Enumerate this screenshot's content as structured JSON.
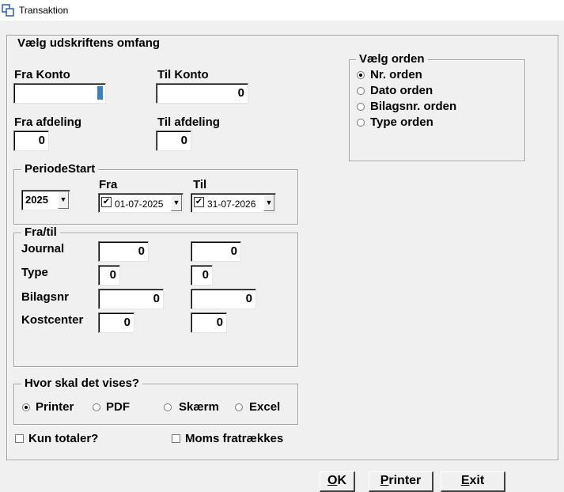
{
  "window": {
    "title": "Transaktion"
  },
  "scope": {
    "legend": "Vælg udskriftens omfang",
    "fra_konto": {
      "label": "Fra Konto",
      "value": ""
    },
    "til_konto": {
      "label": "Til Konto",
      "value": "0"
    },
    "fra_afdeling": {
      "label": "Fra afdeling",
      "value": "0"
    },
    "til_afdeling": {
      "label": "Til afdeling",
      "value": "0"
    }
  },
  "periode": {
    "legend": "PeriodeStart",
    "year": "2025",
    "fra_label": "Fra",
    "til_label": "Til",
    "fra_date": "01-07-2025",
    "til_date": "31-07-2026",
    "fra_checked": true,
    "til_checked": true
  },
  "fratil": {
    "legend": "Fra/til",
    "rows": [
      {
        "label": "Journal",
        "from": "0",
        "to": "0"
      },
      {
        "label": "Type",
        "from": "0",
        "to": "0"
      },
      {
        "label": "Bilagsnr",
        "from": "0",
        "to": "0"
      },
      {
        "label": "Kostcenter",
        "from": "0",
        "to": "0"
      }
    ]
  },
  "output": {
    "legend": "Hvor skal det vises?",
    "options": [
      "Printer",
      "PDF",
      "Skærm",
      "Excel"
    ],
    "selected": "Printer"
  },
  "order": {
    "legend": "Vælg orden",
    "options": [
      "Nr. orden",
      "Dato orden",
      "Bilagsnr. orden",
      "Type orden"
    ],
    "selected": "Nr. orden"
  },
  "checkboxes": {
    "kun_totaler": {
      "label": "Kun totaler?",
      "checked": false
    },
    "moms": {
      "label": "Moms fratrækkes",
      "checked": false
    }
  },
  "buttons": {
    "ok": {
      "mnemonic": "O",
      "rest": "K"
    },
    "printer": {
      "mnemonic": "P",
      "rest": "rinter"
    },
    "exit": {
      "mnemonic": "E",
      "rest": "xit"
    }
  },
  "icons": {
    "app": "transaction-windows-icon",
    "dropdown": "chevron-down-icon",
    "check": "checkmark-icon"
  },
  "colors": {
    "background": "#f0f0f0",
    "titlebar": "#ffffff",
    "caret": "#3a7ec4"
  }
}
